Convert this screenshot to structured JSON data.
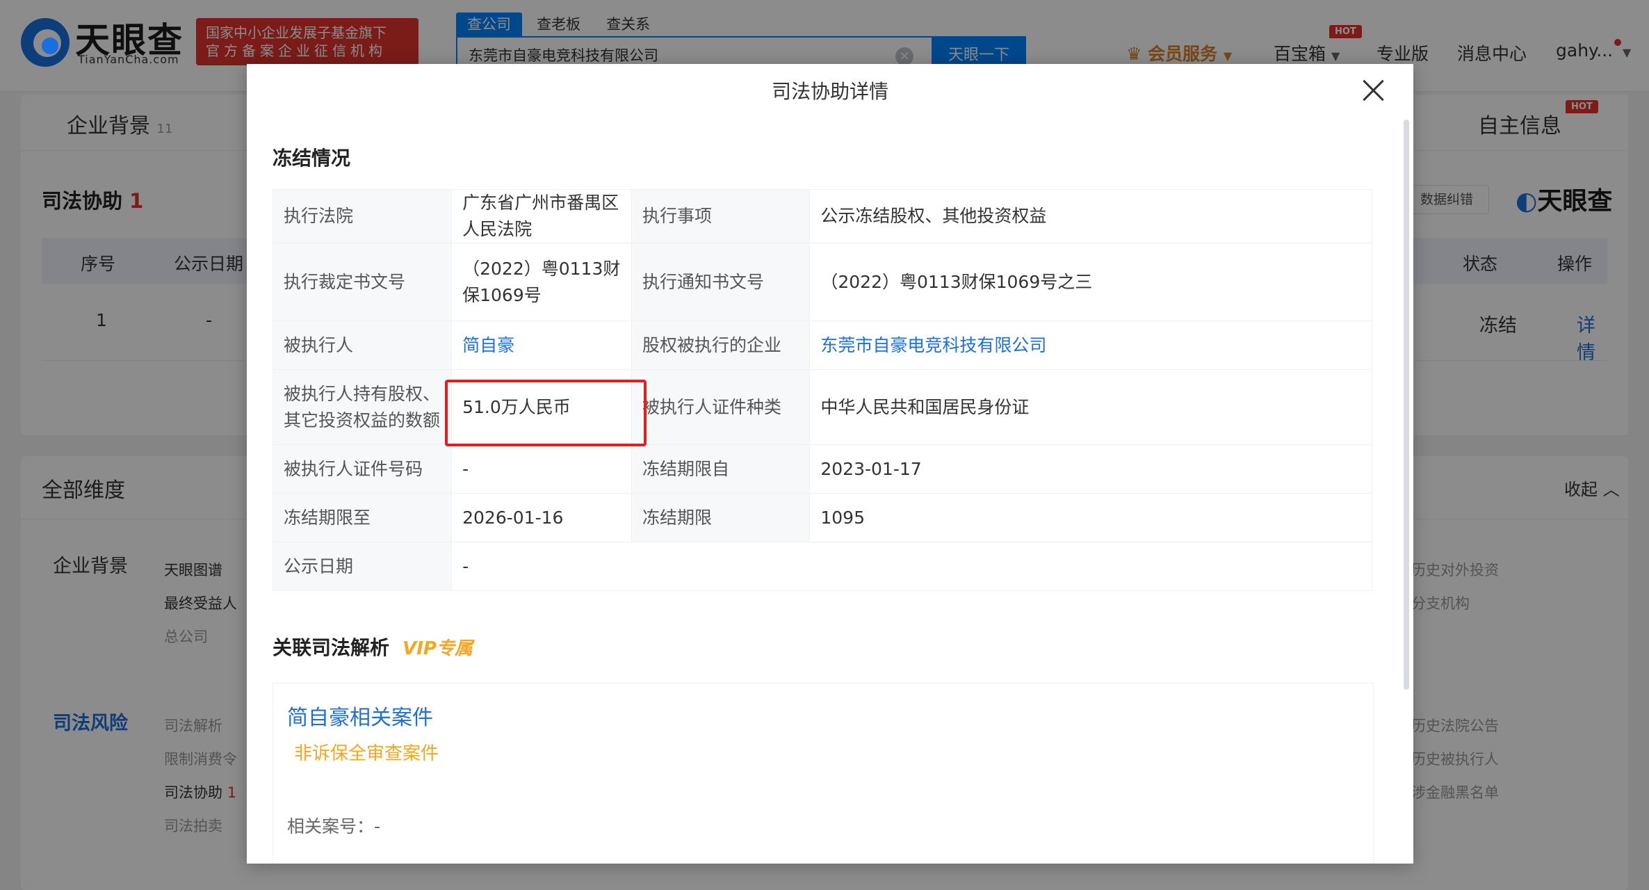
{
  "header": {
    "logo_text": "天眼查",
    "logo_sub": "TianYanCha.com",
    "badge_line1": "国家中小企业发展子基金旗下",
    "badge_line2": "官方备案企业征信机构",
    "search_tabs": [
      "查公司",
      "查老板",
      "查关系"
    ],
    "search_value": "东莞市自豪电竞科技有限公司",
    "search_button": "天眼一下",
    "nav": {
      "member": "会员服务",
      "baibao": "百宝箱",
      "hot": "HOT",
      "pro": "专业版",
      "messages": "消息中心",
      "user": "gahy..."
    }
  },
  "page": {
    "tab_company_bg": "企业背景",
    "tab_company_bg_count": "11",
    "tab_self_info": "自主信息",
    "tab_self_info_hot": "HOT",
    "section_title": "司法协助",
    "section_count": "1",
    "data_fix_button": "数据纠错",
    "watermark_logo": "天眼查",
    "table_headers": [
      "序号",
      "公示日期",
      "状态",
      "操作"
    ],
    "table_row": {
      "index": "1",
      "date": "-",
      "status": "冻结",
      "action": "详情"
    },
    "all_dims_title": "全部维度",
    "collapse": "收起",
    "dims": {
      "company_bg": "企业背景",
      "company_bg_items": [
        "天眼图谱",
        "最终受益人",
        "总公司"
      ],
      "company_bg_right": [
        "历史对外投资",
        "分支机构"
      ],
      "legal_risk": "司法风险",
      "legal_risk_items": [
        "司法解析",
        "限制消费令",
        "司法协助",
        "司法拍卖"
      ],
      "legal_risk_count": "1",
      "legal_risk_right": [
        "历史法院公告",
        "历史被执行人",
        "涉金融黑名单"
      ]
    }
  },
  "modal": {
    "title": "司法协助详情",
    "freeze_title": "冻结情况",
    "rows": [
      {
        "k1": "执行法院",
        "v1": "广东省广州市番禺区人民法院",
        "k2": "执行事项",
        "v2": "公示冻结股权、其他投资权益"
      },
      {
        "k1": "执行裁定书文号",
        "v1": "（2022）粤0113财保1069号",
        "k2": "执行通知书文号",
        "v2": "（2022）粤0113财保1069号之三"
      },
      {
        "k1": "被执行人",
        "v1": "简自豪",
        "k2": "股权被执行的企业",
        "v2": "东莞市自豪电竞科技有限公司"
      },
      {
        "k1": "被执行人持有股权、其它投资权益的数额",
        "v1": "51.0万人民币",
        "k2": "被执行人证件种类",
        "v2": "中华人民共和国居民身份证"
      },
      {
        "k1": "被执行人证件号码",
        "v1": "-",
        "k2": "冻结期限自",
        "v2": "2023-01-17"
      },
      {
        "k1": "冻结期限至",
        "v1": "2026-01-16",
        "k2": "冻结期限",
        "v2": "1095"
      },
      {
        "k1": "公示日期",
        "v1": "-"
      }
    ],
    "related_title": "关联司法解析",
    "vip_label": "VIP专属",
    "related_case_title": "简自豪相关案件",
    "related_case_type": "非诉保全审查案件",
    "related_case_no_label": "相关案号：",
    "related_case_no": "-"
  },
  "colors": {
    "accent": "#0084ff",
    "link": "#1f6fd9",
    "highlight": "#e02020",
    "vip": "#f5a623"
  }
}
